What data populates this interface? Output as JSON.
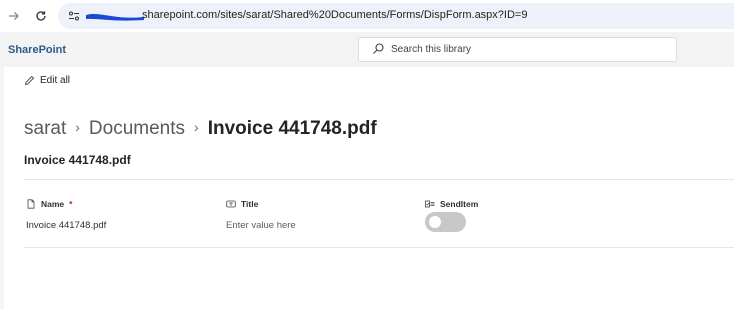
{
  "browser": {
    "url": "sharepoint.com/sites/sarat/Shared%20Documents/Forms/DispForm.aspx?ID=9"
  },
  "header": {
    "brand": "SharePoint",
    "search_placeholder": "Search this library"
  },
  "toolbar": {
    "edit_all_label": "Edit all"
  },
  "breadcrumb": {
    "items": [
      "sarat",
      "Documents"
    ],
    "current": "Invoice 441748.pdf"
  },
  "item": {
    "title": "Invoice 441748.pdf"
  },
  "fields": [
    {
      "label": "Name",
      "required_mark": "*",
      "value": "Invoice 441748.pdf",
      "icon": "document-icon"
    },
    {
      "label": "Title",
      "placeholder": "Enter value here",
      "icon": "text-field-icon"
    },
    {
      "label": "SendItem",
      "value": false,
      "icon": "yes-no-field-icon"
    }
  ]
}
